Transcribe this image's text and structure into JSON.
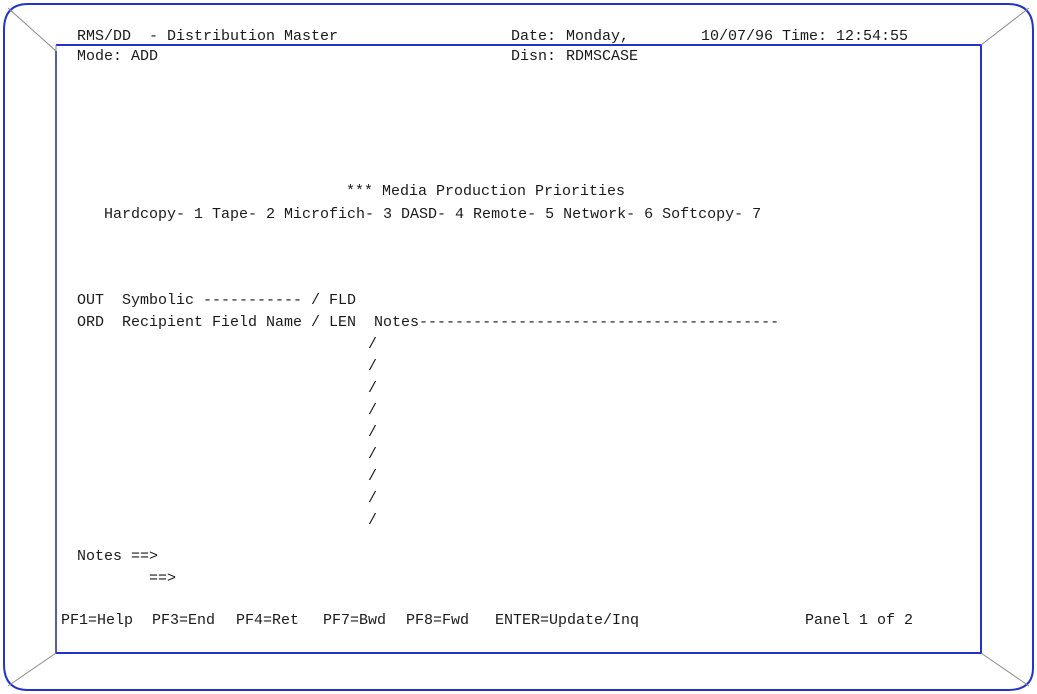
{
  "header": {
    "system": "RMS/DD",
    "separator": "-",
    "screen_title": "Distribution Master",
    "date_label": "Date:",
    "date_value": "Monday,",
    "date_num": "10/07/96",
    "time_label": "Time:",
    "time_value": "12:54:55",
    "mode_label": "Mode:",
    "mode_value": "ADD",
    "disn_label": "Disn:",
    "disn_value": "RDMSCASE"
  },
  "priorities": {
    "title": "*** Media Production Priorities",
    "list": "Hardcopy- 1 Tape- 2 Microfich- 3 DASD- 4 Remote- 5 Network- 6 Softcopy- 7"
  },
  "table": {
    "header1": "OUT  Symbolic ----------- / FLD",
    "header2": "ORD  Recipient Field Name / LEN  Notes----------------------------------------",
    "row_separator": "/",
    "row_count": 9
  },
  "notes": {
    "label": "Notes ==>",
    "continuation": "==>"
  },
  "function_keys": [
    {
      "label": "PF1=Help"
    },
    {
      "label": "PF3=End"
    },
    {
      "label": "PF4=Ret"
    },
    {
      "label": "PF7=Bwd"
    },
    {
      "label": "PF8=Fwd"
    },
    {
      "label": "ENTER=Update/Inq"
    }
  ],
  "panel": "Panel 1 of 2",
  "colors": {
    "frame_blue": "#2233cc",
    "frame_gray": "#8a8a8a",
    "text": "#1a1a1a"
  }
}
